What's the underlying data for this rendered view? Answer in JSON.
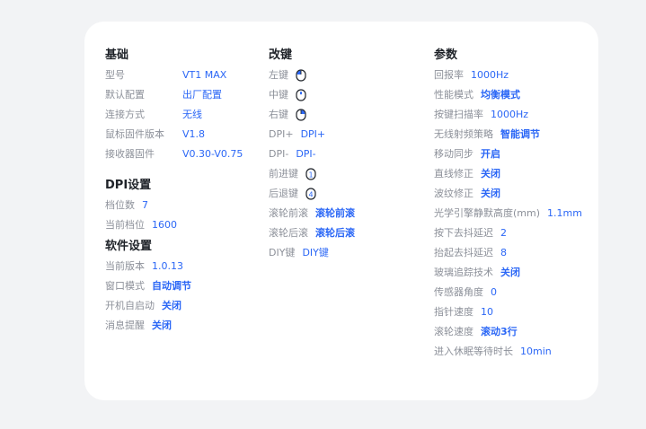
{
  "basic": {
    "title": "基础",
    "rows": [
      {
        "label": "型号",
        "value": "VT1 MAX"
      },
      {
        "label": "默认配置",
        "value": "出厂配置"
      },
      {
        "label": "连接方式",
        "value": "无线"
      },
      {
        "label": "鼠标固件版本",
        "value": "V1.8"
      },
      {
        "label": "接收器固件",
        "value": "V0.30-V0.75"
      }
    ]
  },
  "dpi": {
    "title": "DPI设置",
    "rows": [
      {
        "label": "档位数",
        "value": "7"
      },
      {
        "label": "当前档位",
        "value": "1600"
      }
    ]
  },
  "software": {
    "title": "软件设置",
    "rows": [
      {
        "label": "当前版本",
        "value": "1.0.13"
      },
      {
        "label": "窗口模式",
        "value": "自动调节"
      },
      {
        "label": "开机自启动",
        "value": "关闭"
      },
      {
        "label": "消息提醒",
        "value": "关闭"
      }
    ]
  },
  "keys": {
    "title": "改键",
    "rows": [
      {
        "label": "左键",
        "icon": "mouse-left-icon"
      },
      {
        "label": "中键",
        "icon": "mouse-middle-icon"
      },
      {
        "label": "右键",
        "icon": "mouse-right-icon"
      },
      {
        "label": "DPI+",
        "value": "DPI+"
      },
      {
        "label": "DPI-",
        "value": "DPI-"
      },
      {
        "label": "前进键",
        "icon": "mouse-forward-icon"
      },
      {
        "label": "后退键",
        "icon": "mouse-back-icon"
      },
      {
        "label": "滚轮前滚",
        "value": "滚轮前滚"
      },
      {
        "label": "滚轮后滚",
        "value": "滚轮后滚"
      },
      {
        "label": "DIY键",
        "value": "DIY键"
      }
    ]
  },
  "params": {
    "title": "参数",
    "rows": [
      {
        "label": "回报率",
        "value": "1000Hz"
      },
      {
        "label": "性能模式",
        "value": "均衡模式"
      },
      {
        "label": "按键扫描率",
        "value": "1000Hz"
      },
      {
        "label": "无线射频策略",
        "value": "智能调节"
      },
      {
        "label": "移动同步",
        "value": "开启"
      },
      {
        "label": "直线修正",
        "value": "关闭"
      },
      {
        "label": "波纹修正",
        "value": "关闭"
      },
      {
        "label": "光学引擎静默高度(mm)",
        "value": "1.1mm"
      },
      {
        "label": "按下去抖延迟",
        "value": "2"
      },
      {
        "label": "抬起去抖延迟",
        "value": "8"
      },
      {
        "label": "玻璃追踪技术",
        "value": "关闭"
      },
      {
        "label": "传感器角度",
        "value": "0"
      },
      {
        "label": "指针速度",
        "value": "10"
      },
      {
        "label": "滚轮速度",
        "value": "滚动3行"
      },
      {
        "label": "进入休眠等待时长",
        "value": "10min"
      }
    ]
  },
  "colors": {
    "accent": "#2b67f6",
    "label": "#8c9099",
    "title": "#1f2329",
    "card": "#ffffff",
    "background": "#f2f3f5"
  }
}
